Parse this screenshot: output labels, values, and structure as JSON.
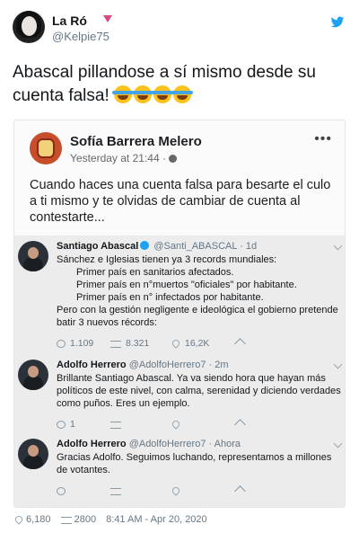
{
  "tweet": {
    "display_name": "La Ró",
    "handle": "@Kelpie75",
    "text": "Abascal pillandose a sí mismo desde su cuenta falsa! ",
    "emoji": [
      "😂",
      "😂",
      "😂",
      "😂"
    ],
    "likes": "6,180",
    "retweets": "2800",
    "timestamp": "8:41 AM - Apr 20, 2020",
    "icons": {
      "avatar": "profile-photo",
      "badge": "pink-heart-icon",
      "logo": "twitter-bird-icon"
    }
  },
  "fb_post": {
    "author": "Sofía Barrera Melero",
    "time": "Yesterday at 21:44 ·",
    "more": "•••",
    "text": "Cuando haces una cuenta falsa para besarte el culo a ti mismo y te olvidas de cambiar de cuenta al contestarte..."
  },
  "embedded_thread": [
    {
      "name": "Santiago Abascal",
      "verified": true,
      "handle": "@Santi_ABASCAL",
      "time": "· 1d",
      "lines": [
        "Sánchez e Iglesias tienen ya 3 records mundiales:",
        "Primer país en sanitarios afectados.",
        "Primer país en n°muertos \"oficiales\" por habitante.",
        "Primer país en n° infectados por habitante.",
        "Pero con la gestión negligente e ideológica el gobierno pretende batir 3 nuevos récords:"
      ],
      "replies": "1.109",
      "retweets": "8.321",
      "likes": "16,2K"
    },
    {
      "name": "Adolfo Herrero",
      "verified": false,
      "handle": "@AdolfoHerrero7",
      "time": "· 2m",
      "text": "Brillante Santiago Abascal. Ya va siendo hora que hayan más políticos de este nivel, con calma, serenidad y diciendo verdades como puños. Eres un ejemplo.",
      "replies": "1",
      "retweets": "",
      "likes": ""
    },
    {
      "name": "Adolfo Herrero",
      "verified": false,
      "handle": "@AdolfoHerrero7",
      "time": "· Ahora",
      "text": "Gracias Adolfo. Seguimos luchando, representamos a millones de votantes.",
      "replies": "",
      "retweets": "",
      "likes": ""
    }
  ]
}
